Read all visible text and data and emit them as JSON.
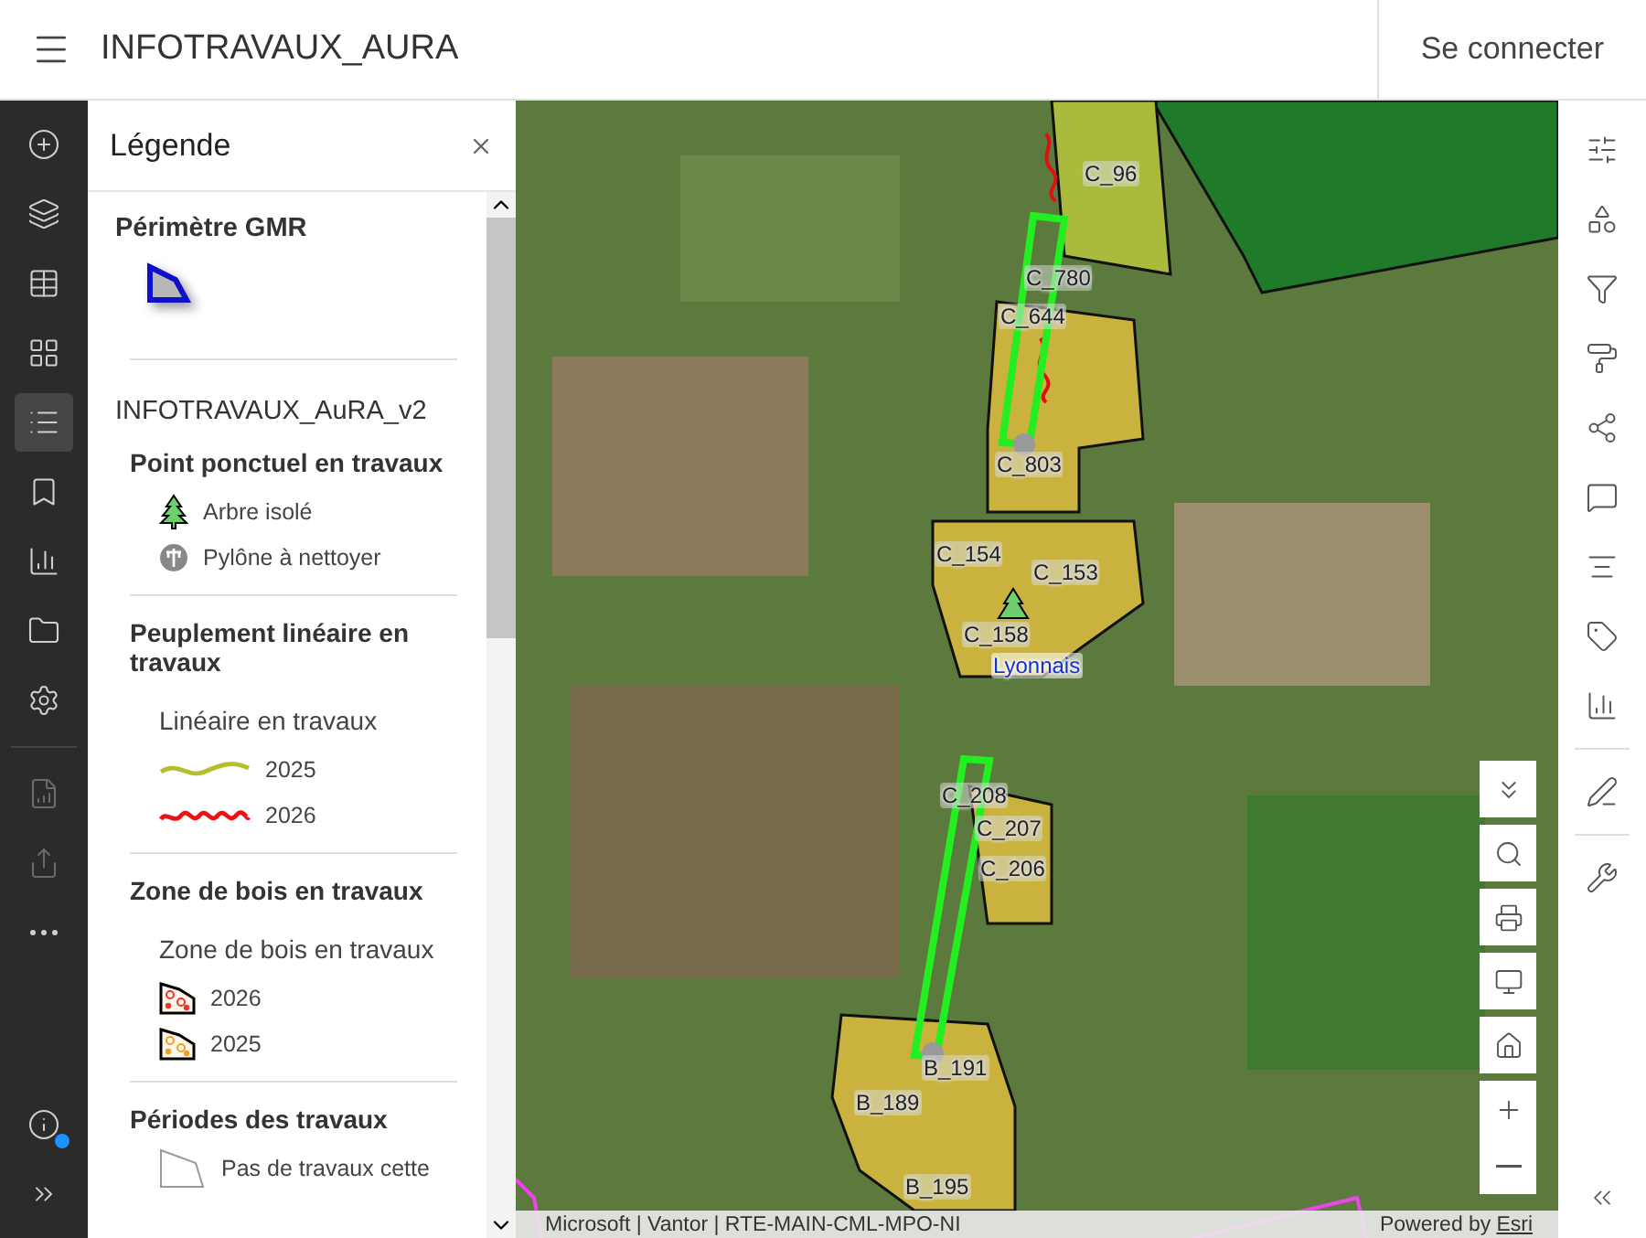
{
  "header": {
    "title": "INFOTRAVAUX_AURA",
    "login": "Se connecter"
  },
  "rail_items": [
    {
      "selected": false,
      "disabled": false
    },
    {
      "selected": false,
      "disabled": false
    },
    {
      "selected": false,
      "disabled": false
    },
    {
      "selected": false,
      "disabled": false
    },
    {
      "selected": true,
      "disabled": false
    },
    {
      "selected": false,
      "disabled": false
    },
    {
      "selected": false,
      "disabled": false
    },
    {
      "selected": false,
      "disabled": false
    },
    {
      "selected": false,
      "disabled": false
    },
    {
      "selected": false,
      "disabled": true
    },
    {
      "selected": false,
      "disabled": true
    },
    {
      "selected": false,
      "disabled": false
    }
  ],
  "legend": {
    "title": "Légende",
    "blocks": [
      {
        "kind": "layer-title",
        "text": "Périmètre GMR"
      },
      {
        "kind": "perimeter"
      },
      {
        "kind": "divider"
      },
      {
        "kind": "layer-title",
        "text": "INFOTRAVAUX_AuRA_v2"
      },
      {
        "kind": "group-title",
        "text": "Point ponctuel en travaux"
      },
      {
        "kind": "tree",
        "label": "Arbre isolé"
      },
      {
        "kind": "pylon",
        "label": "Pylône à nettoyer"
      },
      {
        "kind": "divider"
      },
      {
        "kind": "group-title",
        "text": "Peuplement linéaire en travaux"
      },
      {
        "kind": "caption",
        "text": "Linéaire en travaux"
      },
      {
        "kind": "line-2025",
        "label": "2025"
      },
      {
        "kind": "line-2026",
        "label": "2026"
      },
      {
        "kind": "divider"
      },
      {
        "kind": "group-title",
        "text": "Zone de bois en travaux"
      },
      {
        "kind": "caption",
        "text": "Zone de bois en travaux"
      },
      {
        "kind": "zone-2026",
        "label": "2026"
      },
      {
        "kind": "zone-2025",
        "label": "2025"
      },
      {
        "kind": "divider"
      },
      {
        "kind": "group-title",
        "text": "Périodes des travaux"
      },
      {
        "kind": "empty-zone",
        "label": "Pas de travaux cette"
      }
    ]
  },
  "map": {
    "labels": [
      {
        "text": "C_96",
        "kind": "parcel"
      },
      {
        "text": "C_780",
        "kind": "parcel"
      },
      {
        "text": "C_644",
        "kind": "parcel"
      },
      {
        "text": "C_803",
        "kind": "parcel"
      },
      {
        "text": "C_154",
        "kind": "parcel"
      },
      {
        "text": "C_153",
        "kind": "parcel"
      },
      {
        "text": "C_158",
        "kind": "parcel"
      },
      {
        "text": "Lyonnais",
        "kind": "place"
      },
      {
        "text": "C_208",
        "kind": "parcel"
      },
      {
        "text": "C_207",
        "kind": "parcel"
      },
      {
        "text": "C_206",
        "kind": "parcel"
      },
      {
        "text": "B_191",
        "kind": "parcel"
      },
      {
        "text": "B_189",
        "kind": "parcel"
      },
      {
        "text": "B_195",
        "kind": "parcel"
      }
    ],
    "attribution": "Microsoft | Vantor | RTE-MAIN-CML-MPO-NI",
    "powered_by": "Powered by",
    "powered_link": "Esri"
  }
}
